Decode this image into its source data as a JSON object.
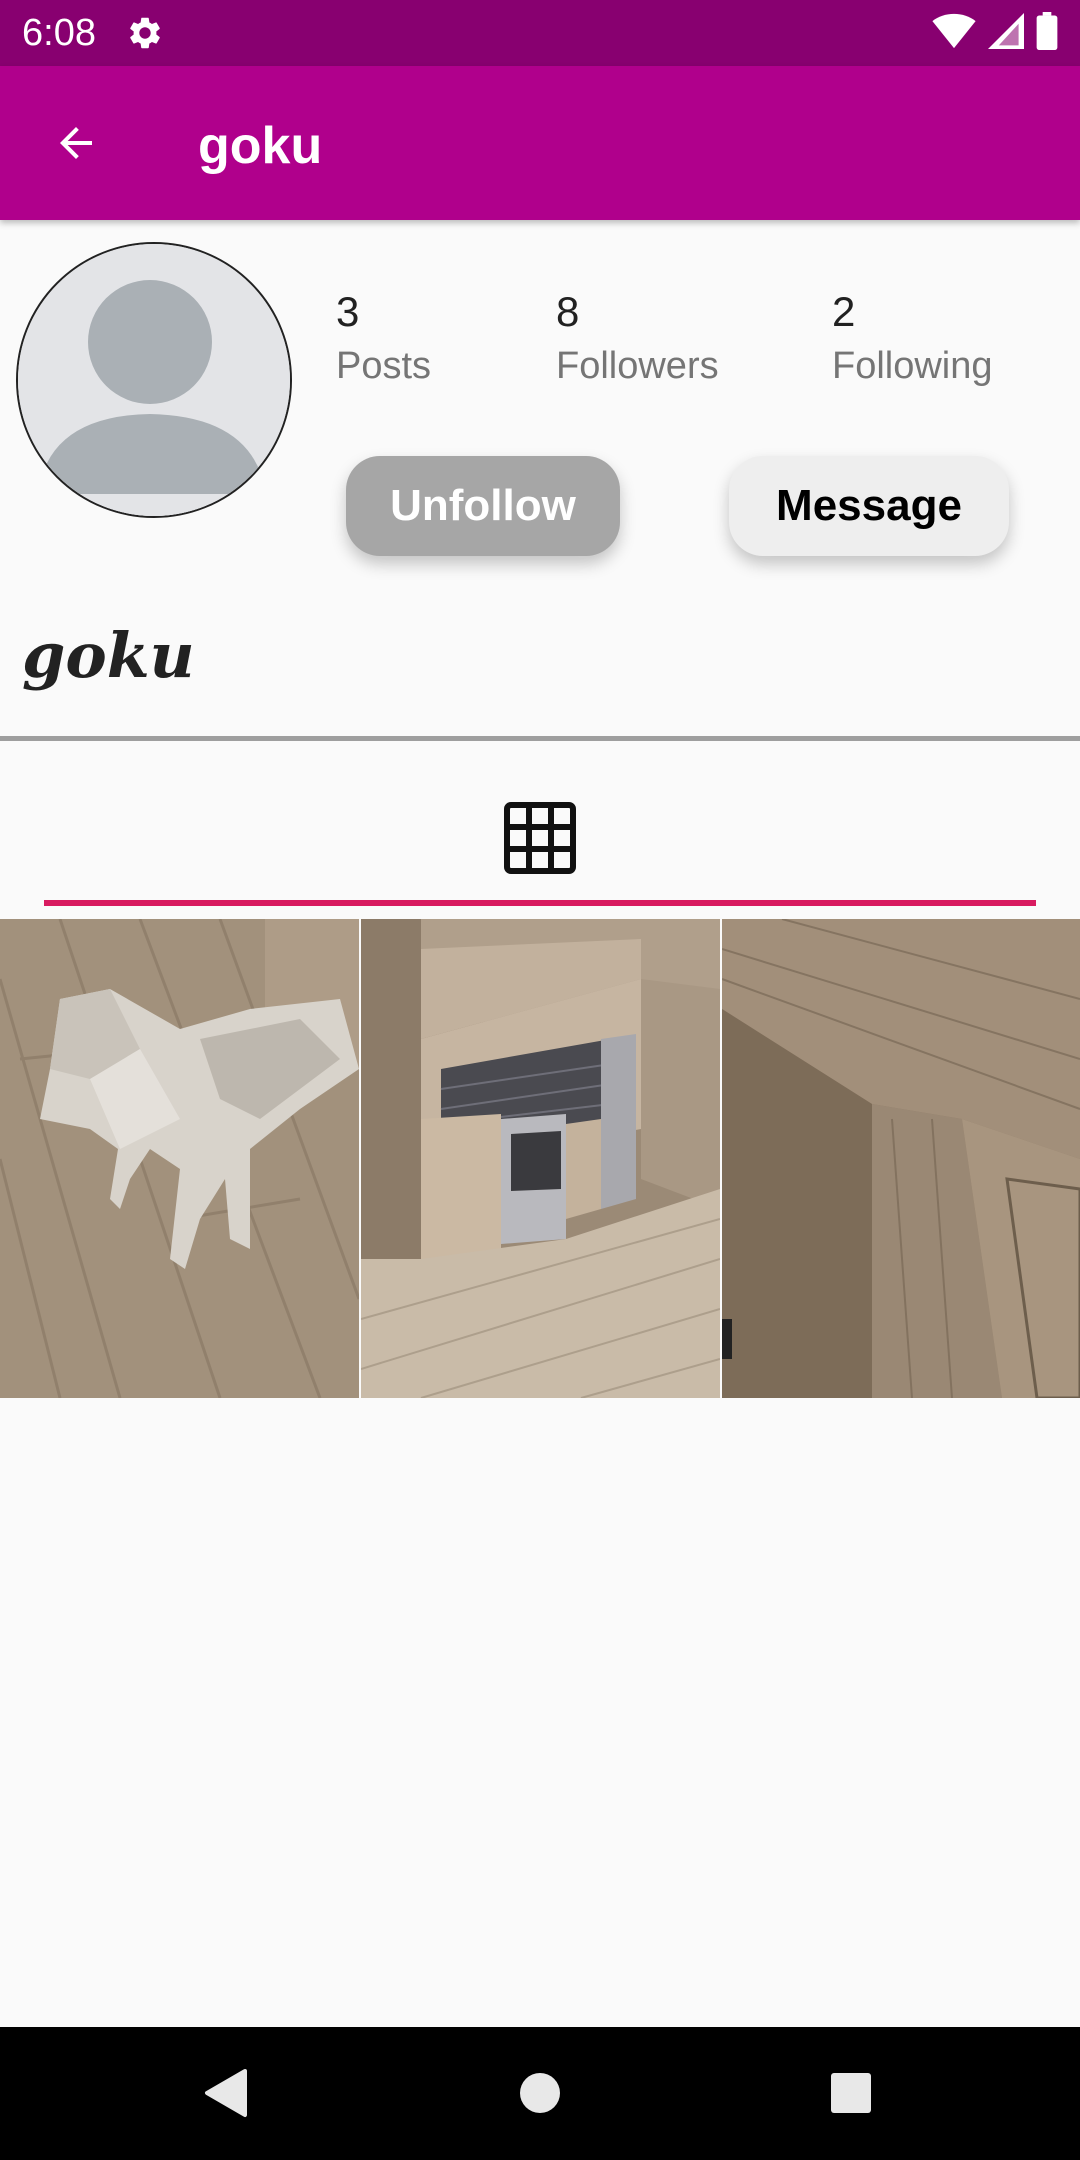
{
  "status_bar": {
    "time": "6:08",
    "icons": [
      "settings-icon",
      "wifi-icon",
      "signal-icon",
      "battery-icon"
    ],
    "background": "#880070"
  },
  "app_bar": {
    "title": "goku",
    "back_icon": "arrow-back-icon",
    "background": "#b0008c"
  },
  "profile": {
    "avatar_icon": "default-person-avatar",
    "stats": [
      {
        "count": "3",
        "label": "Posts"
      },
      {
        "count": "8",
        "label": "Followers"
      },
      {
        "count": "2",
        "label": "Following"
      }
    ],
    "actions": {
      "unfollow_label": "Unfollow",
      "message_label": "Message"
    },
    "display_name": "goku"
  },
  "tabs": {
    "items": [
      {
        "icon": "grid-icon",
        "selected": true
      }
    ],
    "indicator_color": "#d81b60"
  },
  "posts": [
    {
      "thumbnail": "low-poly dog on wooden floor"
    },
    {
      "thumbnail": "kitchen interior with cabinets and stove"
    },
    {
      "thumbnail": "wooden room corner"
    }
  ],
  "nav_bar": {
    "buttons": [
      "back-triangle-icon",
      "home-circle-icon",
      "recents-square-icon"
    ]
  }
}
